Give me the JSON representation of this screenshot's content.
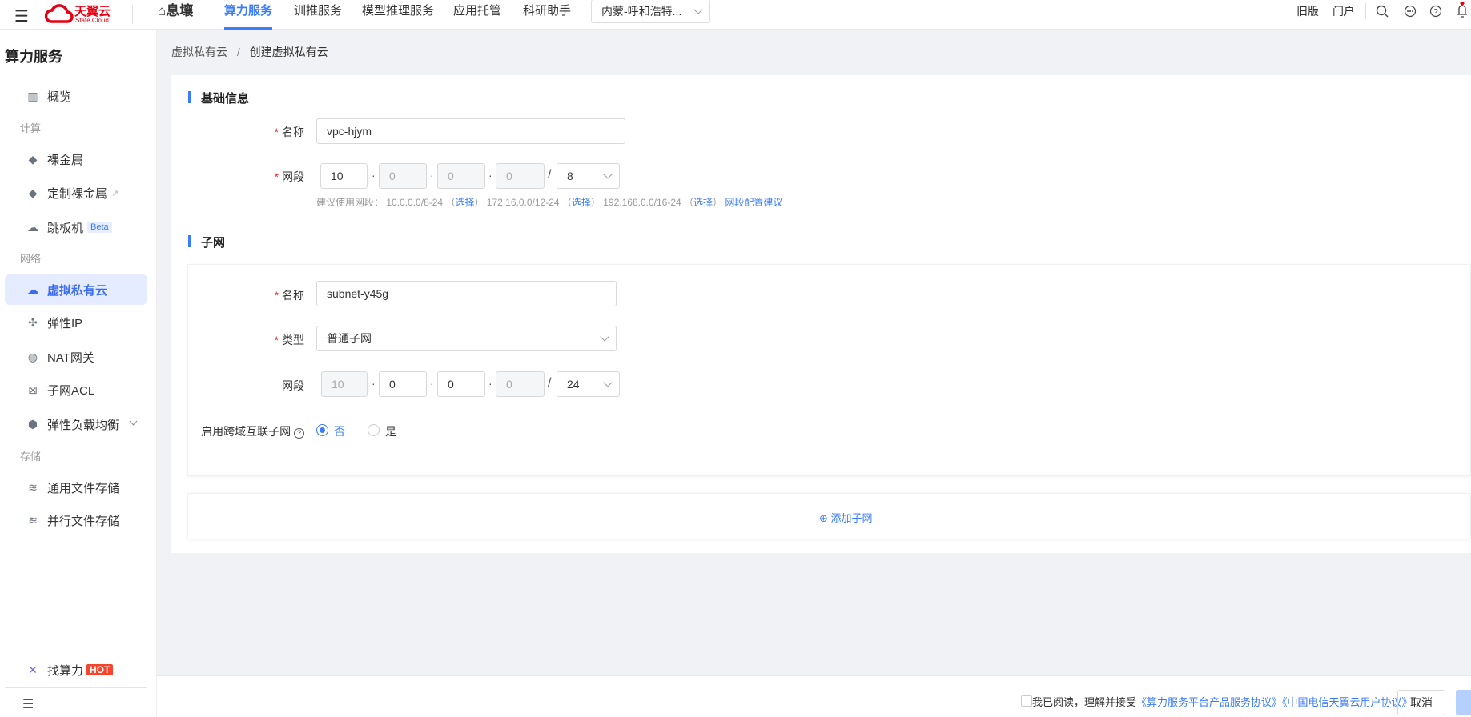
{
  "topbar": {
    "brand": "天翼云",
    "brand_sub": "State Cloud",
    "product": "息壤",
    "tabs": [
      {
        "label": "算力服务",
        "active": true
      },
      {
        "label": "训推服务"
      },
      {
        "label": "模型推理服务"
      },
      {
        "label": "应用托管"
      },
      {
        "label": "科研助手"
      }
    ],
    "region": "内蒙-呼和浩特...",
    "old_version": "旧版",
    "portal": "门户"
  },
  "sidebar": {
    "title": "算力服务",
    "items": [
      {
        "label": "概览"
      },
      {
        "group": "计算"
      },
      {
        "label": "裸金属"
      },
      {
        "label": "定制裸金属"
      },
      {
        "label": "跳板机",
        "badge": "Beta"
      },
      {
        "group": "网络"
      },
      {
        "label": "虚拟私有云",
        "active": true
      },
      {
        "label": "弹性IP"
      },
      {
        "label": "NAT网关"
      },
      {
        "label": "子网ACL"
      },
      {
        "label": "弹性负载均衡"
      },
      {
        "group": "存储"
      },
      {
        "label": "通用文件存储"
      },
      {
        "label": "并行文件存储"
      }
    ],
    "find": {
      "label": "找算力",
      "badge": "HOT"
    }
  },
  "breadcrumb": {
    "parent": "虚拟私有云",
    "sep": "/",
    "current": "创建虚拟私有云"
  },
  "basic": {
    "title": "基础信息",
    "name_label": "名称",
    "name_value": "vpc-hjym",
    "cidr_label": "网段",
    "cidr": [
      "10",
      "0",
      "0",
      "0"
    ],
    "mask": "8",
    "hint_prefix": "建议使用网段：",
    "suggestions": [
      {
        "range": "10.0.0.0/8-24",
        "action": "选择"
      },
      {
        "range": "172.16.0.0/12-24",
        "action": "选择"
      },
      {
        "range": "192.168.0.0/16-24",
        "action": "选择"
      }
    ],
    "advice_link": "网段配置建议"
  },
  "subnet": {
    "title": "子网",
    "name_label": "名称",
    "name_value": "subnet-y45g",
    "type_label": "类型",
    "type_value": "普通子网",
    "cidr_label": "网段",
    "cidr": [
      "10",
      "0",
      "0",
      "0"
    ],
    "mask": "24",
    "cross_label": "启用跨域互联子网",
    "options": [
      {
        "label": "否",
        "checked": true
      },
      {
        "label": "是",
        "checked": false
      }
    ],
    "add_label": "添加子网"
  },
  "footer": {
    "agree_text": "我已阅读，理解并接受",
    "link1": "《算力服务平台产品服务协议》",
    "link2": "《中国电信天翼云用户协议》",
    "cancel": "取消"
  },
  "colors": {
    "accent": "#3b7cff",
    "brand": "#e60012"
  }
}
